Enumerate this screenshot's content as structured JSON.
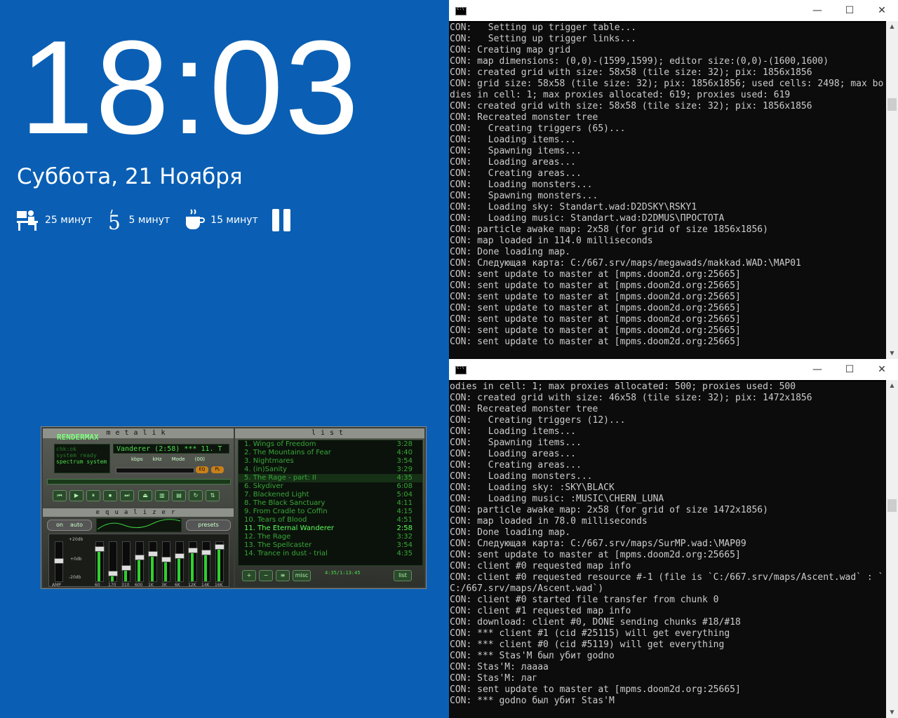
{
  "desktop": {
    "clock": "18:03",
    "date": "Суббота, 21 Ноября",
    "timers": [
      {
        "icon": "work-desk-icon",
        "label": "25 минут"
      },
      {
        "icon": "five-icon",
        "label": "5 минут"
      },
      {
        "icon": "coffee-cup-icon",
        "label": "15 минут"
      }
    ],
    "pause_icon": "pause-icon"
  },
  "player": {
    "logo": "RENDERMAX",
    "title_left": "metalik",
    "title_right": "list",
    "status_line1": "chk:ok",
    "status_line2": "system ready",
    "status_line3": "spectrum system",
    "track_display": "Vanderer (2:58) *** 11. T",
    "kbps_label": "kbps",
    "khz_label": "kHz",
    "mode_label": "Mode",
    "mode_value": "(00)",
    "eq_button": "EQ",
    "pl_button": "PL",
    "eq_title": "equalizer",
    "eq_on": "on",
    "eq_auto": "auto",
    "eq_presets": "presets",
    "eq_db_top": "+20db",
    "eq_db_mid": "+0db",
    "eq_db_bot": "-20db",
    "eq_preamp": "AMP",
    "eq_bands": [
      {
        "label": "60",
        "level": 0.85
      },
      {
        "label": "170",
        "level": 0.15
      },
      {
        "label": "310",
        "level": 0.3
      },
      {
        "label": "600",
        "level": 0.6
      },
      {
        "label": "1K",
        "level": 0.7
      },
      {
        "label": "3K",
        "level": 0.55
      },
      {
        "label": "6K",
        "level": 0.65
      },
      {
        "label": "12K",
        "level": 0.8
      },
      {
        "label": "14K",
        "level": 0.75
      },
      {
        "label": "16K",
        "level": 0.9
      }
    ],
    "playlist": [
      {
        "n": "1. Wings of Freedom",
        "t": "3:28"
      },
      {
        "n": "2. The Mountains of Fear",
        "t": "4:40"
      },
      {
        "n": "3. Nightmares",
        "t": "3:54"
      },
      {
        "n": "4. (in)Sanity",
        "t": "3:29"
      },
      {
        "n": "5. The Rage - part: II",
        "t": "4:35"
      },
      {
        "n": "6. Skydiver",
        "t": "6:08"
      },
      {
        "n": "7. Blackened Light",
        "t": "5:04"
      },
      {
        "n": "8. The Black Sanctuary",
        "t": "4:11"
      },
      {
        "n": "9. From Cradle to Coffin",
        "t": "4:15"
      },
      {
        "n": "10. Tears of Blood",
        "t": "4:51"
      },
      {
        "n": "11. The Eternal Wanderer",
        "t": "2:58"
      },
      {
        "n": "12. The Rage",
        "t": "3:32"
      },
      {
        "n": "13. The Spellcaster",
        "t": "3:54"
      },
      {
        "n": "14. Trance in dust - trial",
        "t": "4:35"
      }
    ],
    "playlist_time": "4:35/1:13:45",
    "list_button": "list",
    "misc_button": "misc"
  },
  "console1": {
    "lines": [
      "CON:   Setting up trigger table...",
      "CON:   Setting up trigger links...",
      "CON: Creating map grid",
      "CON: map dimensions: (0,0)-(1599,1599); editor size:(0,0)-(1600,1600)",
      "CON: created grid with size: 58x58 (tile size: 32); pix: 1856x1856",
      "CON: grid size: 58x58 (tile size: 32); pix: 1856x1856; used cells: 2498; max bodies in cell: 1; max proxies allocated: 619; proxies used: 619",
      "CON: created grid with size: 58x58 (tile size: 32); pix: 1856x1856",
      "CON: Recreated monster tree",
      "CON:   Creating triggers (65)...",
      "CON:   Loading items...",
      "CON:   Spawning items...",
      "CON:   Loading areas...",
      "CON:   Creating areas...",
      "CON:   Loading monsters...",
      "CON:   Spawning monsters...",
      "CON:   Loading sky: Standart.wad:D2DSKY\\RSKY1",
      "CON:   Loading music: Standart.wad:D2DMUS\\ПРОСТОТА",
      "CON: particle awake map: 2x58 (for grid of size 1856x1856)",
      "CON: map loaded in 114.0 milliseconds",
      "CON: Done loading map.",
      "CON: Следующая карта: C:/667.srv/maps/megawads/makkad.WAD:\\MAP01",
      "CON: sent update to master at [mpms.doom2d.org:25665]",
      "CON: sent update to master at [mpms.doom2d.org:25665]",
      "CON: sent update to master at [mpms.doom2d.org:25665]",
      "CON: sent update to master at [mpms.doom2d.org:25665]",
      "CON: sent update to master at [mpms.doom2d.org:25665]",
      "CON: sent update to master at [mpms.doom2d.org:25665]",
      "CON: sent update to master at [mpms.doom2d.org:25665]"
    ]
  },
  "console2": {
    "lines": [
      "odies in cell: 1; max proxies allocated: 500; proxies used: 500",
      "CON: created grid with size: 46x58 (tile size: 32); pix: 1472x1856",
      "CON: Recreated monster tree",
      "CON:   Creating triggers (12)...",
      "CON:   Loading items...",
      "CON:   Spawning items...",
      "CON:   Loading areas...",
      "CON:   Creating areas...",
      "CON:   Loading monsters...",
      "CON:   Loading sky: :SKY\\BLACK",
      "CON:   Loading music: :MUSIC\\CHERN_LUNA",
      "CON: particle awake map: 2x58 (for grid of size 1472x1856)",
      "CON: map loaded in 78.0 milliseconds",
      "CON: Done loading map.",
      "CON: Следующая карта: C:/667.srv/maps/SurMP.wad:\\MAP09",
      "CON: sent update to master at [mpms.doom2d.org:25665]",
      "CON: client #0 requested map info",
      "CON: client #0 requested resource #-1 (file is `C:/667.srv/maps/Ascent.wad` : `C:/667.srv/maps/Ascent.wad`)",
      "CON: client #0 started file transfer from chunk 0",
      "CON: client #1 requested map info",
      "CON: download: client #0, DONE sending chunks #18/#18",
      "CON: *** client #1 (cid #25115) will get everything",
      "CON: *** client #0 (cid #5119) will get everything",
      "CON: *** Stas'M был убит godno",
      "CON: Stas'M: лаааа",
      "CON: Stas'M: лаг",
      "CON: sent update to master at [mpms.doom2d.org:25665]",
      "CON: *** godno был убит Stas'M"
    ]
  },
  "window_controls": {
    "minimize": "—",
    "maximize": "☐",
    "close": "✕"
  }
}
